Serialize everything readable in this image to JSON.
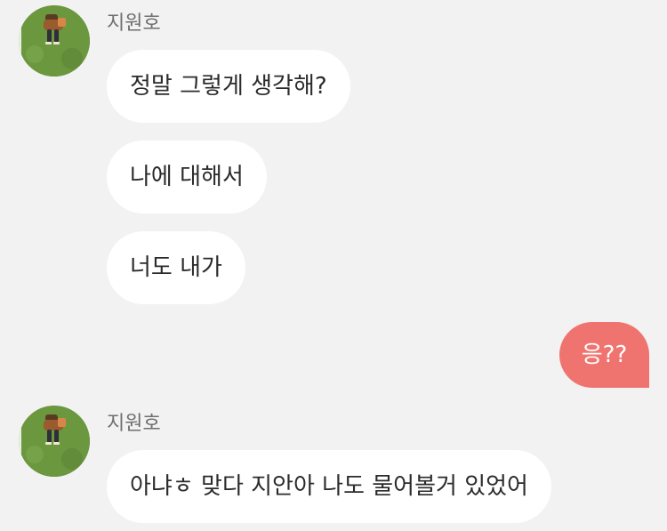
{
  "conversation": {
    "groups": [
      {
        "sender": "지원호",
        "avatar": "user-avatar-photo",
        "messages": [
          "정말 그렇게 생각해?",
          "나에 대해서",
          "너도 내가"
        ]
      },
      {
        "sender": "지원호",
        "avatar": "user-avatar-photo",
        "messages": [
          "아냐ㅎ 맞다 지안아 나도 물어볼거 있었어"
        ]
      }
    ],
    "outgoing": [
      "응??"
    ]
  },
  "colors": {
    "background": "#f2f2f2",
    "incoming_bubble": "#ffffff",
    "outgoing_bubble": "#ef7470",
    "sender_name": "#6f6f6f",
    "message_text": "#2b2b2b"
  }
}
